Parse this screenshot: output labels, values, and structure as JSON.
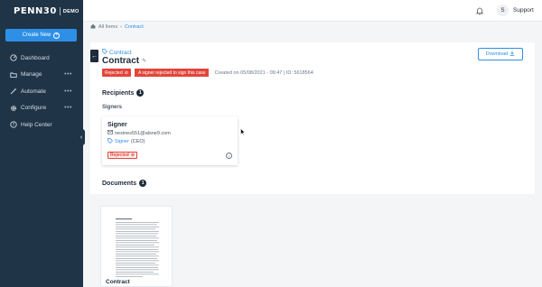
{
  "brand": {
    "logo_text": "PENN30",
    "tag": "DEMO"
  },
  "sidebar": {
    "create_label": "Create New",
    "items": [
      {
        "label": "Dashboard",
        "icon": "dashboard-icon",
        "more": ""
      },
      {
        "label": "Manage",
        "icon": "folder-icon",
        "more": "•••"
      },
      {
        "label": "Automate",
        "icon": "magic-wand-icon",
        "more": "•••"
      },
      {
        "label": "Configure",
        "icon": "gear-icon",
        "more": "•••"
      },
      {
        "label": "Help Center",
        "icon": "help-icon",
        "more": ""
      }
    ]
  },
  "topbar": {
    "avatar_initial": "S",
    "user_label": "Support"
  },
  "breadcrumb": {
    "root": "All Items",
    "separator": "›",
    "current": "Contract"
  },
  "case": {
    "type_label": "Contract",
    "title": "Contract",
    "status": "Rejected",
    "status_reason": "A signer rejected to sign this case",
    "meta": "Created on 05/08/2021 - 09:47 | ID: 5618564",
    "download_label": "Download"
  },
  "recipients": {
    "title": "Recipients",
    "count": "1",
    "group_title": "Signers",
    "signer": {
      "name": "Signer",
      "email": "nexines551@alsne9.com",
      "role_link": "Signer",
      "role_suffix": "(CEO)",
      "status": "Rejected"
    }
  },
  "documents": {
    "title": "Documents",
    "count": "1",
    "items": [
      {
        "name": "Contract"
      }
    ]
  },
  "colors": {
    "sidebar": "#1f3447",
    "accent": "#2e8fe6",
    "danger": "#e2453b"
  }
}
